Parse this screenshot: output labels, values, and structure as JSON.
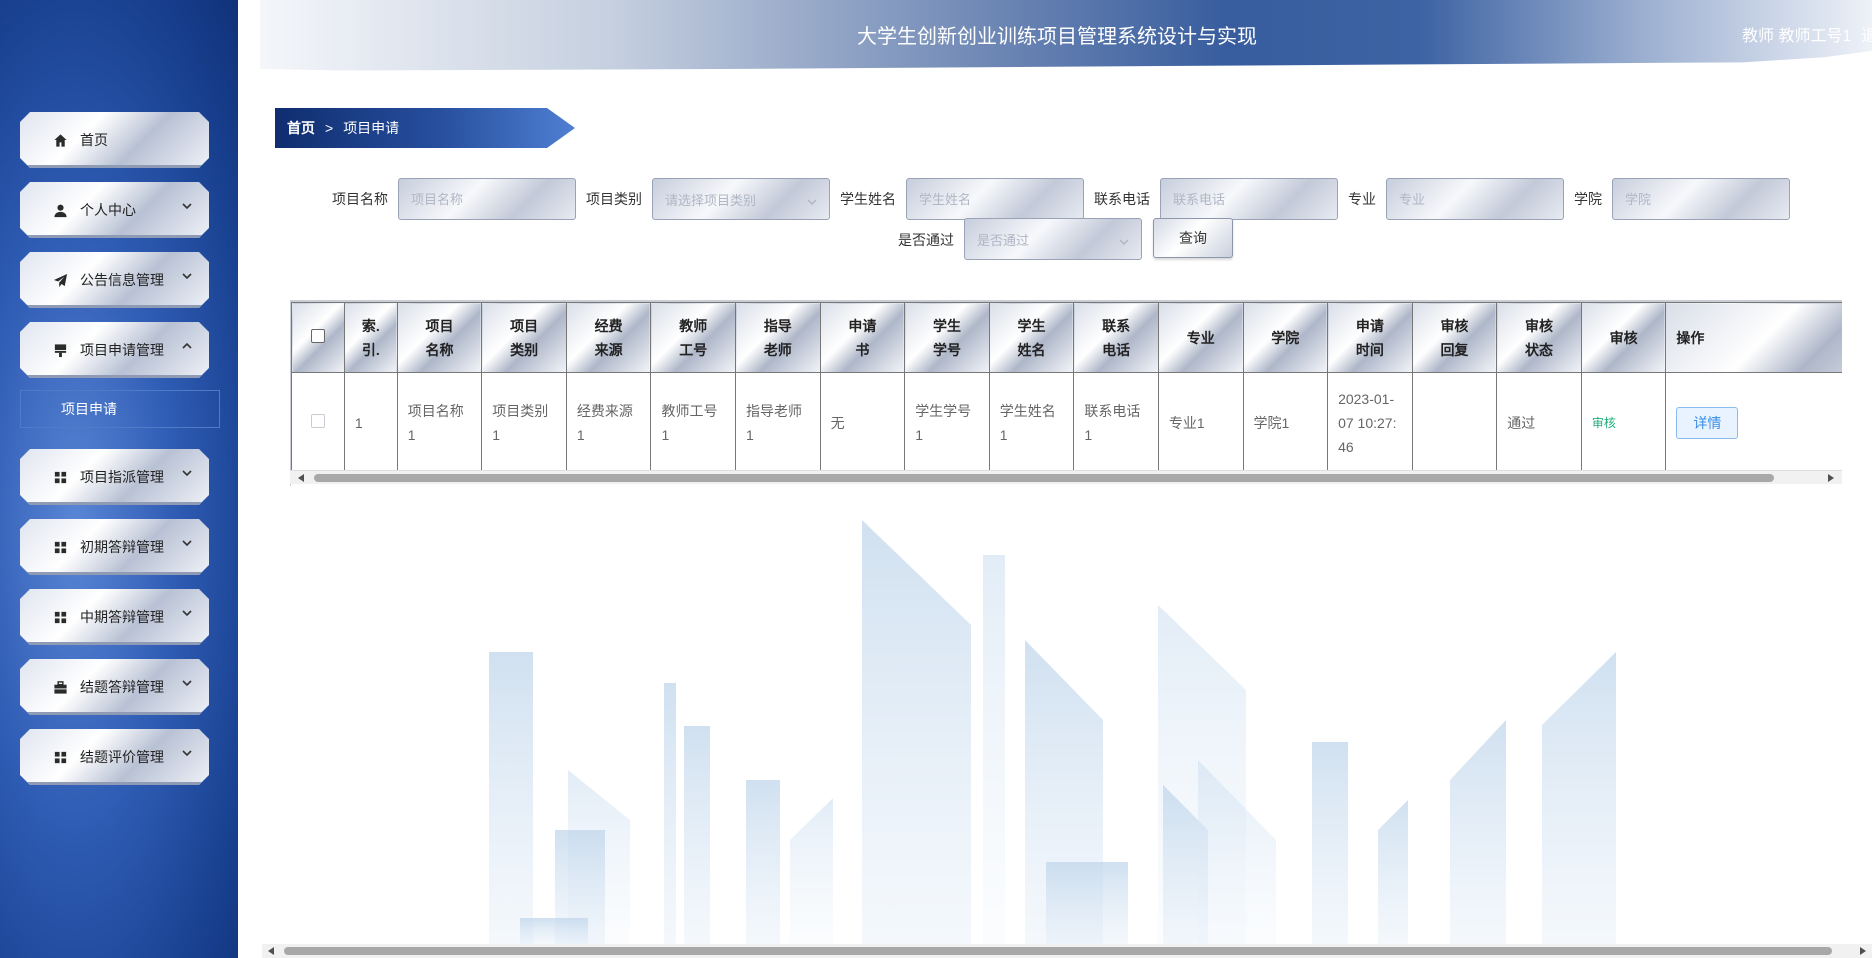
{
  "header": {
    "title": "大学生创新创业训练项目管理系统设计与实现",
    "user": "教师 教师工号1",
    "logout": "退出登录"
  },
  "sidebar": {
    "items": [
      {
        "label": "首页",
        "icon": "home-icon"
      },
      {
        "label": "个人中心",
        "icon": "user-icon"
      },
      {
        "label": "公告信息管理",
        "icon": "send-icon"
      },
      {
        "label": "项目申请管理",
        "icon": "stamp-icon",
        "expanded": true
      },
      {
        "label": "项目指派管理",
        "icon": "grid-icon"
      },
      {
        "label": "初期答辩管理",
        "icon": "grid-icon"
      },
      {
        "label": "中期答辩管理",
        "icon": "grid-icon"
      },
      {
        "label": "结题答辩管理",
        "icon": "briefcase-icon"
      },
      {
        "label": "结题评价管理",
        "icon": "grid-icon"
      }
    ],
    "sub_item": "项目申请"
  },
  "breadcrumb": {
    "home": "首页",
    "separator": ">",
    "current": "项目申请"
  },
  "search": {
    "project_name": {
      "label": "项目名称",
      "placeholder": "项目名称"
    },
    "project_type": {
      "label": "项目类别",
      "placeholder": "请选择项目类别"
    },
    "student_name": {
      "label": "学生姓名",
      "placeholder": "学生姓名"
    },
    "phone": {
      "label": "联系电话",
      "placeholder": "联系电话"
    },
    "major": {
      "label": "专业",
      "placeholder": "专业"
    },
    "college": {
      "label": "学院",
      "placeholder": "学院"
    },
    "passed": {
      "label": "是否通过",
      "placeholder": "是否通过"
    },
    "query_button": "查询"
  },
  "table": {
    "headers": [
      "索.\n引.",
      "项目\n名称",
      "项目\n类别",
      "经费\n来源",
      "教师\n工号",
      "指导\n老师",
      "申请\n书",
      "学生\n学号",
      "学生\n姓名",
      "联系\n电话",
      "专业",
      "学院",
      "申请\n时间",
      "审核\n回复",
      "审核\n状态",
      "审核",
      "操作"
    ],
    "rows": [
      {
        "index": "1",
        "project_name": "项目名称1",
        "project_type": "项目类别1",
        "funding": "经费来源1",
        "teacher_id": "教师工号1",
        "advisor": "指导老师1",
        "application": "无",
        "student_id": "学生学号1",
        "student_name": "学生姓名1",
        "phone": "联系电话1",
        "major": "专业1",
        "college": "学院1",
        "apply_time": "2023-01-07 10:27:46",
        "audit_reply": "",
        "audit_status": "通过",
        "audit_action": "审核",
        "detail_button": "详情"
      }
    ]
  },
  "colors": {
    "sidebar_blue": "#2f5cb4",
    "breadcrumb_blue": "#1c3f87",
    "audit_green": "#1fae7a",
    "detail_blue": "#3a8ee6"
  }
}
